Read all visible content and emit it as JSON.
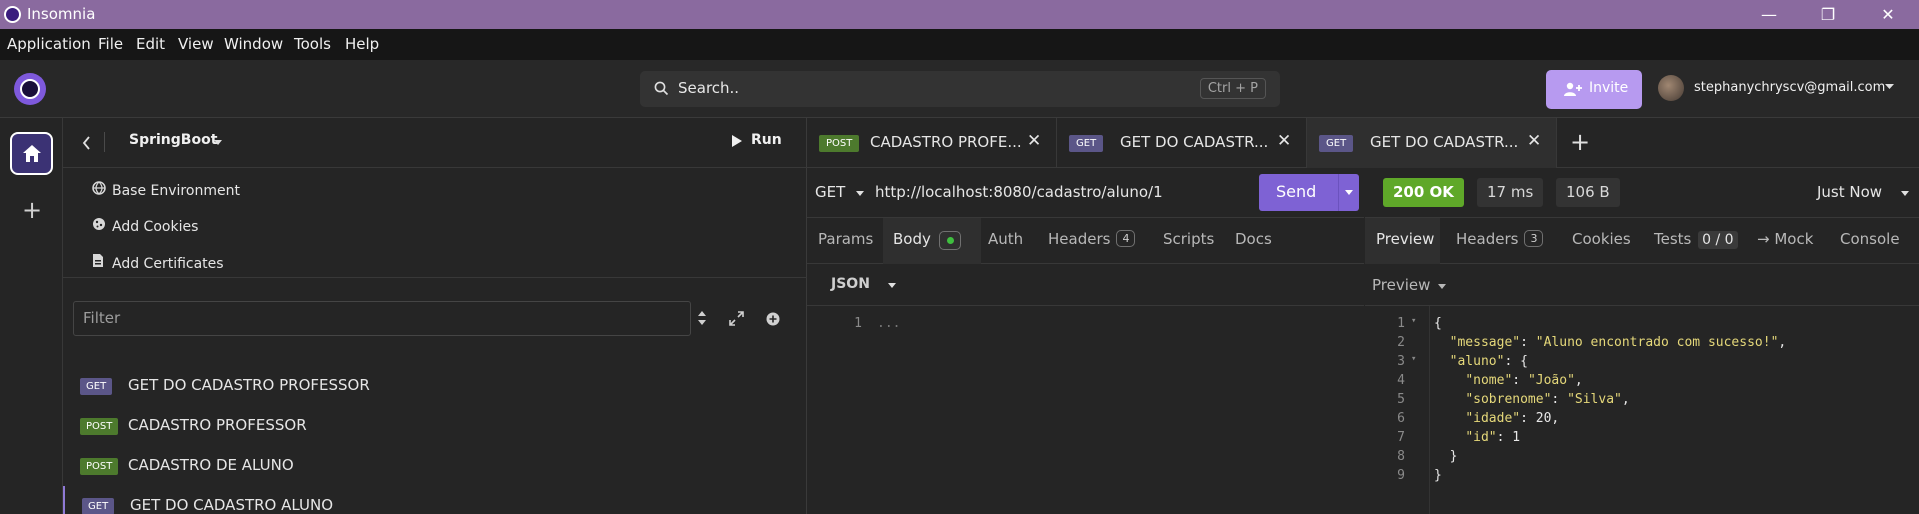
{
  "window": {
    "title": "Insomnia",
    "minimize": "—",
    "maximize": "❐",
    "close": "✕"
  },
  "menu": [
    "Application",
    "File",
    "Edit",
    "View",
    "Window",
    "Tools",
    "Help"
  ],
  "header": {
    "search_placeholder": "Search..",
    "search_shortcut": "Ctrl + P",
    "invite_label": "Invite",
    "user_email": "stephanychryscv@gmail.com"
  },
  "sidebar": {
    "project": "SpringBoot",
    "run_label": "Run",
    "env_items": [
      "Base Environment",
      "Add Cookies",
      "Add Certificates"
    ],
    "filter_placeholder": "Filter",
    "requests": [
      {
        "method": "GET",
        "name": "GET DO CADASTRO PROFESSOR"
      },
      {
        "method": "POST",
        "name": "CADASTRO PROFESSOR"
      },
      {
        "method": "POST",
        "name": "CADASTRO DE ALUNO"
      },
      {
        "method": "GET",
        "name": "GET DO CADASTRO ALUNO"
      }
    ]
  },
  "tabs": [
    {
      "method": "POST",
      "name": "CADASTRO PROFE..."
    },
    {
      "method": "GET",
      "name": "GET DO CADASTR..."
    },
    {
      "method": "GET",
      "name": "GET DO CADASTR..."
    }
  ],
  "request": {
    "method": "GET",
    "url": "http://localhost:8080/cadastro/aluno/1",
    "send_label": "Send",
    "tabs": [
      "Params",
      "Body",
      "Auth",
      "Headers",
      "Scripts",
      "Docs"
    ],
    "headers_count": "4",
    "body_type": "JSON",
    "body_line": "1",
    "body_text": "..."
  },
  "response": {
    "status": "200 OK",
    "time": "17 ms",
    "size": "106 B",
    "when": "Just Now",
    "tabs": [
      "Preview",
      "Headers",
      "Cookies",
      "Tests",
      "→ Mock",
      "Console"
    ],
    "headers_count": "3",
    "tests_count": "0 / 0",
    "preview_mode": "Preview",
    "json": {
      "message": "Aluno encontrado com sucesso!",
      "nome": "João",
      "sobrenome": "Silva",
      "idade": "20",
      "id": "1"
    }
  },
  "colors": {
    "accent": "#7e62d4",
    "status_ok": "#5fa829",
    "get_badge": "#5b5688",
    "post_badge": "#4d7a2d"
  }
}
